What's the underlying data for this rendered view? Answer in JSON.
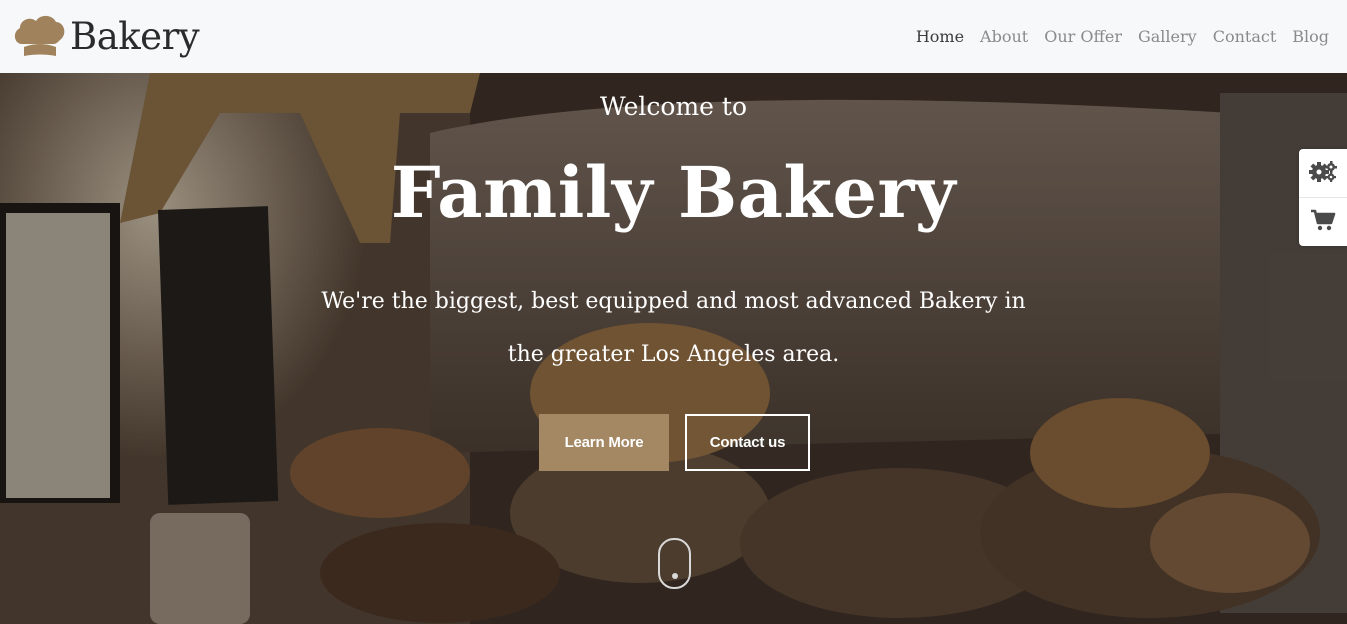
{
  "header": {
    "brand": "Bakery",
    "logo_icon": "chef-hat-icon",
    "nav": [
      {
        "label": "Home",
        "active": true
      },
      {
        "label": "About",
        "active": false
      },
      {
        "label": "Our Offer",
        "active": false
      },
      {
        "label": "Gallery",
        "active": false
      },
      {
        "label": "Contact",
        "active": false
      },
      {
        "label": "Blog",
        "active": false
      }
    ]
  },
  "hero": {
    "welcome": "Welcome to",
    "headline": "Family Bakery",
    "tagline": "We're the biggest, best equipped and most advanced Bakery in the greater Los Angeles area.",
    "buttons": {
      "learn_more": "Learn More",
      "contact": "Contact us"
    },
    "background_icon": "bakery-interior-photo",
    "scroll_icon": "scroll-mouse-icon"
  },
  "side_widget": {
    "settings_icon": "gears-icon",
    "cart_icon": "shopping-cart-icon"
  },
  "colors": {
    "header_bg": "#f7f8fa",
    "accent": "#a38863",
    "nav_text": "#8a8a8a",
    "nav_active": "#3b3b3b",
    "logo": "#a0835c"
  }
}
